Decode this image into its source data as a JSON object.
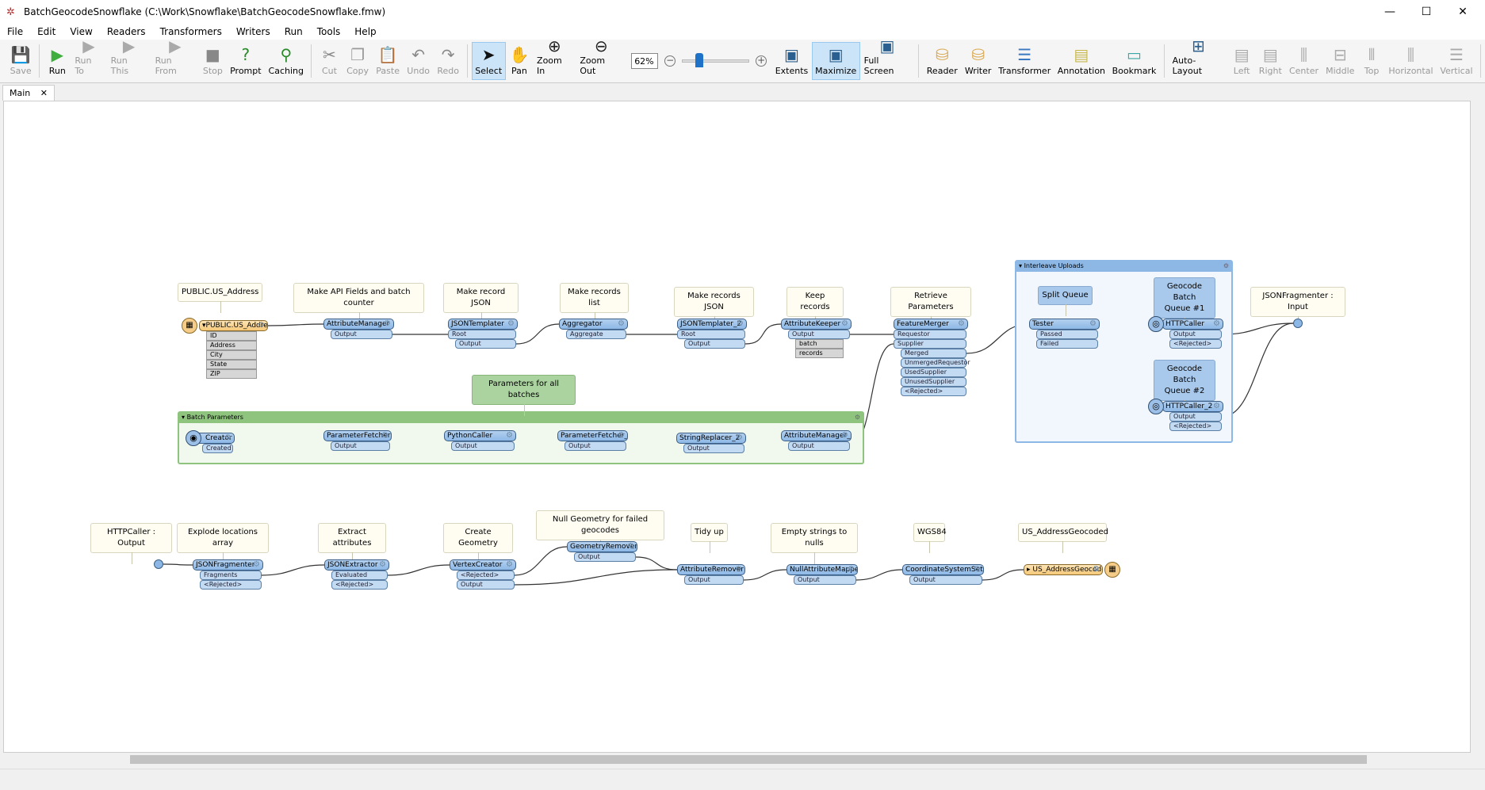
{
  "window": {
    "title": "BatchGeocodeSnowflake (C:\\Work\\Snowflake\\BatchGeocodeSnowflake.fmw)"
  },
  "menu": [
    "File",
    "Edit",
    "View",
    "Readers",
    "Transformers",
    "Writers",
    "Run",
    "Tools",
    "Help"
  ],
  "toolbar": {
    "buttons": [
      {
        "label": "Save",
        "icon": "save-icon",
        "enabled": false
      },
      {
        "label": "Run",
        "icon": "run-icon",
        "enabled": true
      },
      {
        "label": "Run To",
        "icon": "run-to-icon",
        "enabled": false
      },
      {
        "label": "Run This",
        "icon": "run-this-icon",
        "enabled": false
      },
      {
        "label": "Run From",
        "icon": "run-from-icon",
        "enabled": false
      },
      {
        "label": "Stop",
        "icon": "stop-icon",
        "enabled": false
      },
      {
        "label": "Prompt",
        "icon": "prompt-icon",
        "enabled": true
      },
      {
        "label": "Caching",
        "icon": "caching-icon",
        "enabled": true
      },
      {
        "label": "Cut",
        "icon": "cut-icon",
        "enabled": false
      },
      {
        "label": "Copy",
        "icon": "copy-icon",
        "enabled": false
      },
      {
        "label": "Paste",
        "icon": "paste-icon",
        "enabled": false
      },
      {
        "label": "Undo",
        "icon": "undo-icon",
        "enabled": false
      },
      {
        "label": "Redo",
        "icon": "redo-icon",
        "enabled": false
      },
      {
        "label": "Select",
        "icon": "select-icon",
        "enabled": true,
        "active": true
      },
      {
        "label": "Pan",
        "icon": "pan-icon",
        "enabled": true
      },
      {
        "label": "Zoom In",
        "icon": "zoom-in-icon",
        "enabled": true
      },
      {
        "label": "Zoom Out",
        "icon": "zoom-out-icon",
        "enabled": true
      }
    ],
    "zoom": {
      "value": "62%",
      "slider_fraction": 0.25
    },
    "buttons2": [
      {
        "label": "Extents",
        "icon": "extents-icon",
        "enabled": true
      },
      {
        "label": "Maximize",
        "icon": "maximize-icon",
        "enabled": true,
        "active": true
      },
      {
        "label": "Full Screen",
        "icon": "full-screen-icon",
        "enabled": true
      },
      {
        "label": "Reader",
        "icon": "reader-icon",
        "enabled": true
      },
      {
        "label": "Writer",
        "icon": "writer-icon",
        "enabled": true
      },
      {
        "label": "Transformer",
        "icon": "transformer-icon",
        "enabled": true
      },
      {
        "label": "Annotation",
        "icon": "annotation-icon",
        "enabled": true
      },
      {
        "label": "Bookmark",
        "icon": "bookmark-icon",
        "enabled": true
      },
      {
        "label": "Auto-Layout",
        "icon": "auto-layout-icon",
        "enabled": true
      },
      {
        "label": "Left",
        "icon": "align-left-icon",
        "enabled": false
      },
      {
        "label": "Right",
        "icon": "align-right-icon",
        "enabled": false
      },
      {
        "label": "Center",
        "icon": "align-center-icon",
        "enabled": false
      },
      {
        "label": "Middle",
        "icon": "align-middle-icon",
        "enabled": false
      },
      {
        "label": "Top",
        "icon": "align-top-icon",
        "enabled": false
      },
      {
        "label": "Horizontal",
        "icon": "distribute-horizontal-icon",
        "enabled": false
      },
      {
        "label": "Vertical",
        "icon": "distribute-vertical-icon",
        "enabled": false
      }
    ]
  },
  "tabs": [
    {
      "label": "Main"
    }
  ],
  "bookmarks": [
    {
      "id": "bp",
      "title": "Batch Parameters",
      "color": "#8fc47f",
      "fill": "#f1f8ee"
    },
    {
      "id": "iu",
      "title": "Interleave Uploads",
      "color": "#8db8e6",
      "fill": "#f2f7fd"
    }
  ],
  "annotations": [
    {
      "id": "a1",
      "text": "PUBLIC.US_Address"
    },
    {
      "id": "a2",
      "text": "Make API Fields and batch counter"
    },
    {
      "id": "a3",
      "text": "Make record JSON"
    },
    {
      "id": "a4",
      "text": "Make records list"
    },
    {
      "id": "a5",
      "text": "Make records JSON"
    },
    {
      "id": "a6",
      "text": "Keep records"
    },
    {
      "id": "a7",
      "text": "Retrieve Parameters"
    },
    {
      "id": "a8",
      "text": "Split Queue",
      "style": "blue"
    },
    {
      "id": "a9",
      "text": "Geocode Batch\nQueue #1",
      "style": "blue"
    },
    {
      "id": "a10",
      "text": "Geocode Batch\nQueue #2",
      "style": "blue"
    },
    {
      "id": "a11",
      "text": "JSONFragmenter : Input"
    },
    {
      "id": "a12",
      "text": "Parameters for all batches",
      "style": "green"
    },
    {
      "id": "a13",
      "text": "HTTPCaller : Output"
    },
    {
      "id": "a14",
      "text": "Explode locations array"
    },
    {
      "id": "a15",
      "text": "Extract attributes"
    },
    {
      "id": "a16",
      "text": "Create Geometry"
    },
    {
      "id": "a17",
      "text": "Null Geometry for failed geocodes"
    },
    {
      "id": "a18",
      "text": "Tidy up"
    },
    {
      "id": "a19",
      "text": "Empty strings to nulls"
    },
    {
      "id": "a20",
      "text": "WGS84"
    },
    {
      "id": "a21",
      "text": "US_AddressGeocoded"
    }
  ],
  "nodes": [
    {
      "id": "reader",
      "name": "PUBLIC.US_Address",
      "kind": "reader",
      "attributes": [
        "ID",
        "Address",
        "City",
        "State",
        "ZIP"
      ]
    },
    {
      "id": "am",
      "name": "AttributeManager",
      "ports": [
        {
          "label": "Output"
        }
      ]
    },
    {
      "id": "jt",
      "name": "JSONTemplater",
      "ports": [
        {
          "label": "Root",
          "dir": "in"
        },
        {
          "label": "Output"
        }
      ]
    },
    {
      "id": "agg",
      "name": "Aggregator",
      "ports": [
        {
          "label": "Aggregate"
        }
      ]
    },
    {
      "id": "jt2",
      "name": "JSONTemplater_2",
      "ports": [
        {
          "label": "Root",
          "dir": "in"
        },
        {
          "label": "Output"
        }
      ]
    },
    {
      "id": "ak",
      "name": "AttributeKeeper",
      "ports": [
        {
          "label": "Output",
          "attributes": [
            "batch",
            "records"
          ]
        }
      ]
    },
    {
      "id": "fm",
      "name": "FeatureMerger",
      "ports": [
        {
          "label": "Requestor",
          "dir": "in"
        },
        {
          "label": "Supplier",
          "dir": "in"
        },
        {
          "label": "Merged"
        },
        {
          "label": "UnmergedRequestor"
        },
        {
          "label": "UsedSupplier"
        },
        {
          "label": "UnusedSupplier"
        },
        {
          "label": "<Rejected>"
        }
      ]
    },
    {
      "id": "tester",
      "name": "Tester",
      "ports": [
        {
          "label": "Passed"
        },
        {
          "label": "Failed"
        }
      ]
    },
    {
      "id": "hc",
      "name": "HTTPCaller",
      "kind": "http",
      "ports": [
        {
          "label": "Output"
        },
        {
          "label": "<Rejected>"
        }
      ]
    },
    {
      "id": "hc2",
      "name": "HTTPCaller_2",
      "kind": "http",
      "ports": [
        {
          "label": "Output"
        },
        {
          "label": "<Rejected>"
        }
      ]
    },
    {
      "id": "creator",
      "name": "Creator",
      "kind": "creator",
      "ports": [
        {
          "label": "Created"
        }
      ]
    },
    {
      "id": "pf",
      "name": "ParameterFetcher",
      "ports": [
        {
          "label": "Output"
        }
      ]
    },
    {
      "id": "pc",
      "name": "PythonCaller",
      "ports": [
        {
          "label": "Output"
        }
      ]
    },
    {
      "id": "pf2",
      "name": "ParameterFetcher_2",
      "ports": [
        {
          "label": "Output"
        }
      ]
    },
    {
      "id": "sr2",
      "name": "StringReplacer_2",
      "ports": [
        {
          "label": "Output"
        }
      ]
    },
    {
      "id": "am2",
      "name": "AttributeManager_2",
      "ports": [
        {
          "label": "Output"
        }
      ]
    },
    {
      "id": "jf",
      "name": "JSONFragmenter",
      "ports": [
        {
          "label": "Fragments"
        },
        {
          "label": "<Rejected>"
        }
      ]
    },
    {
      "id": "je",
      "name": "JSONExtractor",
      "ports": [
        {
          "label": "Evaluated"
        },
        {
          "label": "<Rejected>"
        }
      ]
    },
    {
      "id": "vc",
      "name": "VertexCreator",
      "ports": [
        {
          "label": "<Rejected>"
        },
        {
          "label": "Output"
        }
      ]
    },
    {
      "id": "gr",
      "name": "GeometryRemover",
      "ports": [
        {
          "label": "Output"
        }
      ]
    },
    {
      "id": "ar",
      "name": "AttributeRemover",
      "ports": [
        {
          "label": "Output"
        }
      ]
    },
    {
      "id": "nam",
      "name": "NullAttributeMapper",
      "ports": [
        {
          "label": "Output"
        }
      ]
    },
    {
      "id": "css",
      "name": "CoordinateSystemSetter",
      "ports": [
        {
          "label": "Output"
        }
      ]
    },
    {
      "id": "writer",
      "name": "US_AddressGeocoded",
      "kind": "writer"
    }
  ]
}
